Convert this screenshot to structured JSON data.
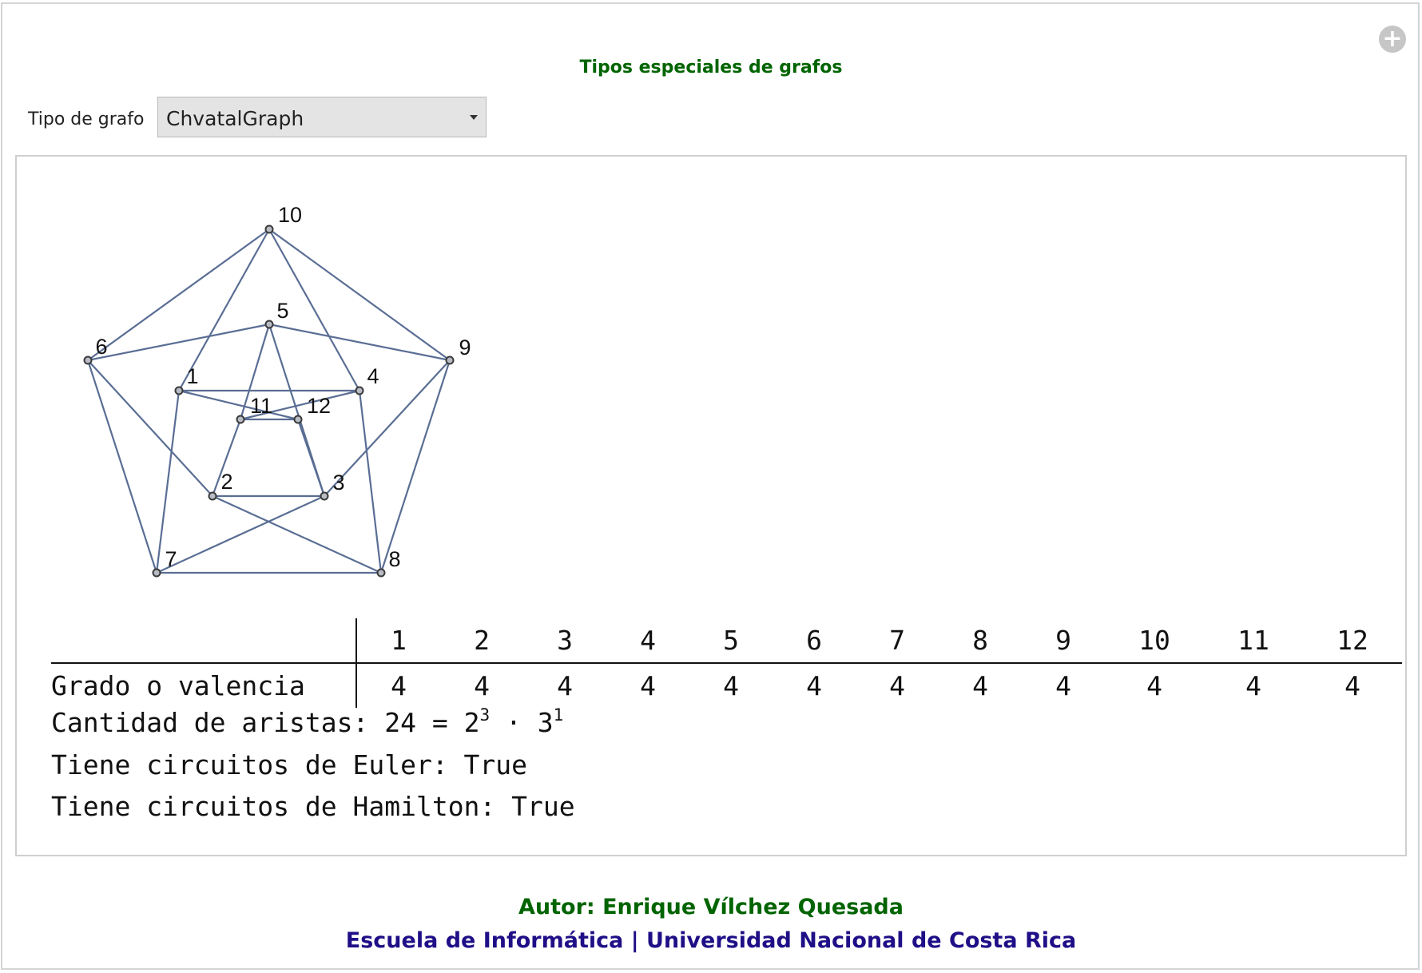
{
  "app": {
    "title": "Tipos especiales de grafos",
    "plus_icon": "plus-circle-icon"
  },
  "controls": {
    "graph_type_label": "Tipo de grafo",
    "graph_type_value": "ChvatalGraph"
  },
  "graph": {
    "name": "ChvatalGraph",
    "vertices": [
      "1",
      "2",
      "3",
      "4",
      "5",
      "6",
      "7",
      "8",
      "9",
      "10",
      "11",
      "12"
    ],
    "edges": [
      [
        "10",
        "6"
      ],
      [
        "10",
        "9"
      ],
      [
        "10",
        "1"
      ],
      [
        "10",
        "4"
      ],
      [
        "5",
        "6"
      ],
      [
        "5",
        "9"
      ],
      [
        "5",
        "11"
      ],
      [
        "5",
        "3"
      ],
      [
        "6",
        "7"
      ],
      [
        "6",
        "2"
      ],
      [
        "9",
        "8"
      ],
      [
        "9",
        "3"
      ],
      [
        "1",
        "12"
      ],
      [
        "1",
        "7"
      ],
      [
        "4",
        "11"
      ],
      [
        "4",
        "8"
      ],
      [
        "11",
        "2"
      ],
      [
        "12",
        "3"
      ],
      [
        "2",
        "3"
      ],
      [
        "2",
        "8"
      ],
      [
        "3",
        "7"
      ],
      [
        "7",
        "8"
      ],
      [
        "11",
        "12"
      ],
      [
        "1",
        "4"
      ]
    ],
    "edge_color": "#5a6e94",
    "vertex_color": "#3a3a3a"
  },
  "degree_table": {
    "header_label": "",
    "row_label": "Grado o valencia",
    "vertices": [
      "1",
      "2",
      "3",
      "4",
      "5",
      "6",
      "7",
      "8",
      "9",
      "10",
      "11",
      "12"
    ],
    "degrees": [
      "4",
      "4",
      "4",
      "4",
      "4",
      "4",
      "4",
      "4",
      "4",
      "4",
      "4",
      "4"
    ]
  },
  "stats": {
    "edges_label": "Cantidad de aristas: ",
    "edges_count": "24",
    "equals": " = ",
    "factor1_base": "2",
    "factor1_exp": "3",
    "dot": " · ",
    "factor2_base": "3",
    "factor2_exp": "1",
    "euler": "Tiene circuitos de Euler: True",
    "hamilton": "Tiene circuitos de Hamilton: True"
  },
  "footer": {
    "author": "Autor: Enrique Vílchez Quesada",
    "school": "Escuela de Informática | Universidad Nacional de Costa Rica"
  }
}
